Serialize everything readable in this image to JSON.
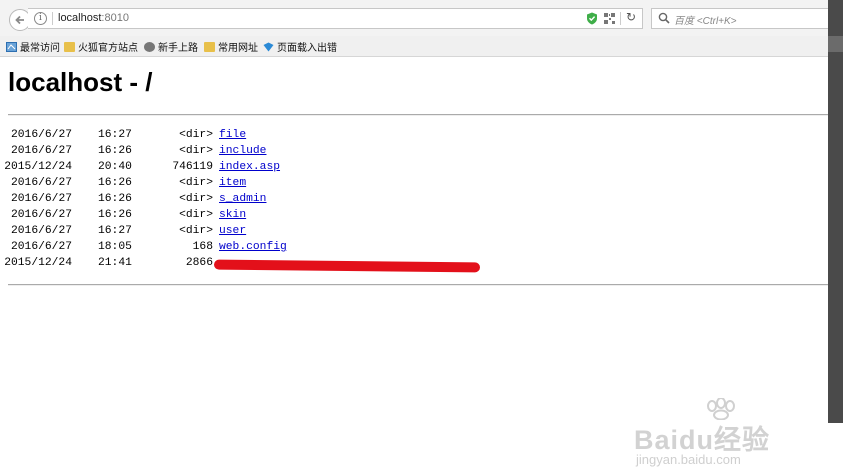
{
  "browser": {
    "url_host": "localhost",
    "url_port": ":8010",
    "search_placeholder": "百度 <Ctrl+K>"
  },
  "bookmarks": [
    {
      "label": "最常访问",
      "icon": "frequent-icon"
    },
    {
      "label": "火狐官方站点",
      "icon": "folder-icon"
    },
    {
      "label": "新手上路",
      "icon": "globe-icon"
    },
    {
      "label": "常用网址",
      "icon": "folder-icon"
    },
    {
      "label": "页面载入出错",
      "icon": "error-page-icon"
    }
  ],
  "page": {
    "title": "localhost - /",
    "entries": [
      {
        "date": "2016/6/27",
        "time": "16:27",
        "size": "<dir>",
        "name": "file"
      },
      {
        "date": "2016/6/27",
        "time": "16:26",
        "size": "<dir>",
        "name": "include"
      },
      {
        "date": "2015/12/24",
        "time": "20:40",
        "size": "746119",
        "name": "index.asp"
      },
      {
        "date": "2016/6/27",
        "time": "16:26",
        "size": "<dir>",
        "name": "item"
      },
      {
        "date": "2016/6/27",
        "time": "16:26",
        "size": "<dir>",
        "name": "s_admin"
      },
      {
        "date": "2016/6/27",
        "time": "16:26",
        "size": "<dir>",
        "name": "skin"
      },
      {
        "date": "2016/6/27",
        "time": "16:27",
        "size": "<dir>",
        "name": "user"
      },
      {
        "date": "2016/6/27",
        "time": "18:05",
        "size": "168",
        "name": "web.config"
      },
      {
        "date": "2015/12/24",
        "time": "21:41",
        "size": "2866",
        "name": ""
      }
    ]
  },
  "watermark": {
    "logo": "Baidu经验",
    "site": "jingyan.baidu.com"
  },
  "colors": {
    "link": "#0000cc",
    "redaction": "#e3101a",
    "shield": "#3fae49"
  }
}
